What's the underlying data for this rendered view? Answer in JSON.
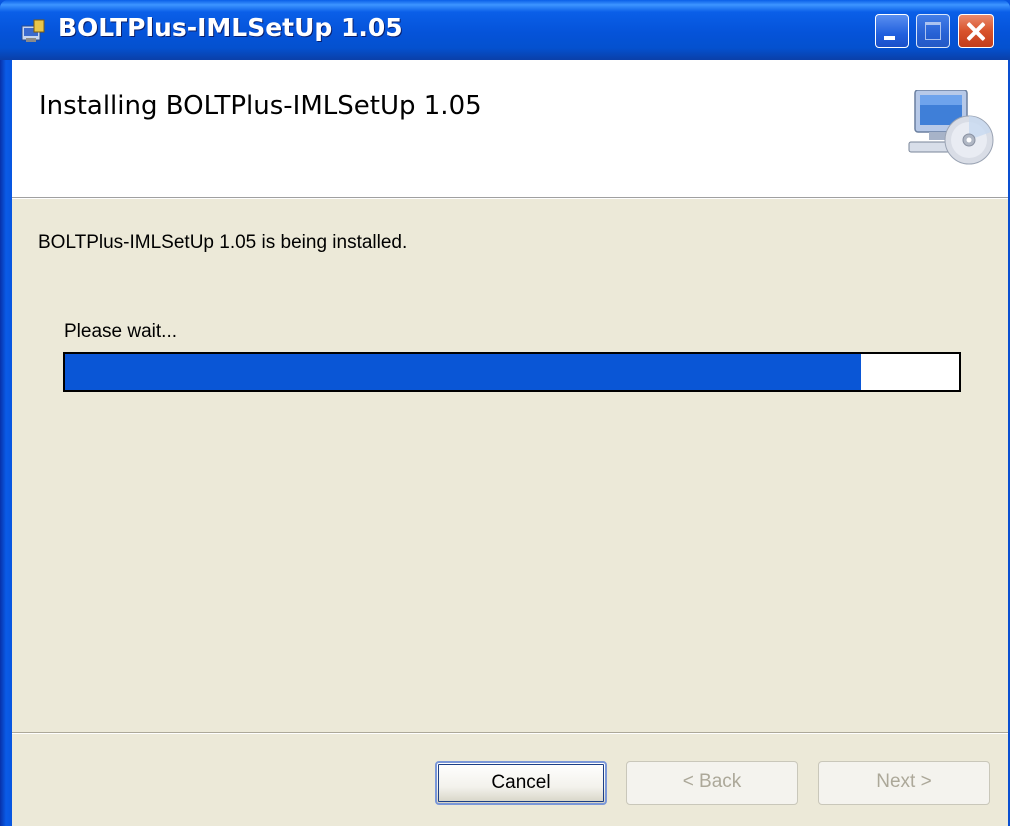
{
  "window": {
    "title": "BOLTPlus-IMLSetUp 1.05",
    "icon": "installer-icon",
    "minimize_icon": "minimize-icon",
    "maximize_icon": "maximize-icon",
    "close_icon": "close-icon"
  },
  "header": {
    "title": "Installing BOLTPlus-IMLSetUp 1.05",
    "icon": "computer-cd-icon"
  },
  "body": {
    "status": "BOLTPlus-IMLSetUp 1.05 is being installed.",
    "wait_label": "Please wait...",
    "progress_fraction": 0.89
  },
  "buttons": {
    "cancel": "Cancel",
    "back": "< Back",
    "next": "Next >"
  },
  "colors": {
    "progress": "#0a56d6",
    "titlebar": "#0553d9",
    "body_bg": "#ece9d8"
  }
}
